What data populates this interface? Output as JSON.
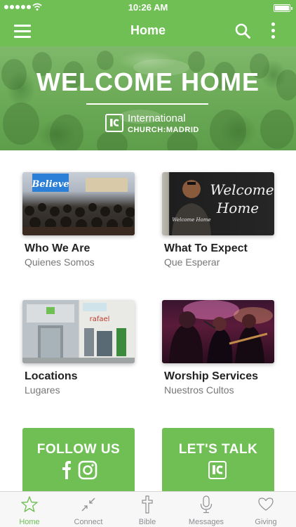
{
  "status_bar": {
    "time": "10:26 AM"
  },
  "nav": {
    "title": "Home"
  },
  "hero": {
    "title": "WELCOME HOME",
    "org_line1": "International",
    "org_line2": "CHURCH:MADRID"
  },
  "cards": [
    {
      "title": "Who We Are",
      "subtitle": "Quienes Somos",
      "image_text": "Believe"
    },
    {
      "title": "What To Expect",
      "subtitle": "Que Esperar",
      "image_text_1": "Welcome",
      "image_text_2": "Home",
      "shirt_text": "Welcome Home"
    },
    {
      "title": "Locations",
      "subtitle": "Lugares",
      "image_text": "rafael"
    },
    {
      "title": "Worship Services",
      "subtitle": "Nuestros Cultos"
    }
  ],
  "actions": [
    {
      "title": "FOLLOW US"
    },
    {
      "title": "LET'S TALK"
    }
  ],
  "tabs": [
    {
      "label": "Home",
      "icon": "star-icon",
      "active": true
    },
    {
      "label": "Connect",
      "icon": "connect-icon",
      "active": false
    },
    {
      "label": "Bible",
      "icon": "cross-icon",
      "active": false
    },
    {
      "label": "Messages",
      "icon": "microphone-icon",
      "active": false
    },
    {
      "label": "Giving",
      "icon": "heart-icon",
      "active": false
    }
  ],
  "colors": {
    "brand_green": "#6fbf55",
    "tab_inactive": "#8e8e93"
  }
}
